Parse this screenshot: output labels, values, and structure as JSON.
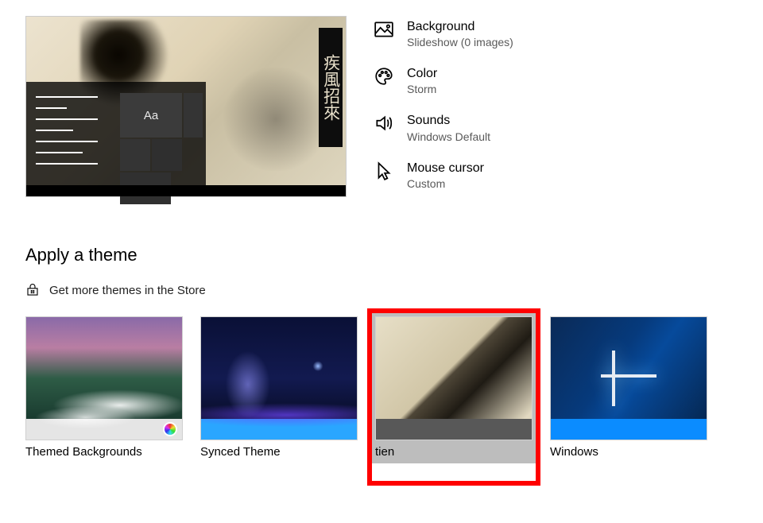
{
  "cjk_banner": "疾風招來",
  "aa_tile": "Aa",
  "settings": {
    "background": {
      "label": "Background",
      "value": "Slideshow (0 images)"
    },
    "color": {
      "label": "Color",
      "value": "Storm"
    },
    "sounds": {
      "label": "Sounds",
      "value": "Windows Default"
    },
    "cursor": {
      "label": "Mouse cursor",
      "value": "Custom"
    }
  },
  "apply": {
    "heading": "Apply a theme",
    "store_link": "Get more themes in the Store"
  },
  "themes": [
    {
      "name": "Themed Backgrounds"
    },
    {
      "name": "Synced Theme"
    },
    {
      "name": "tien"
    },
    {
      "name": "Windows"
    }
  ]
}
